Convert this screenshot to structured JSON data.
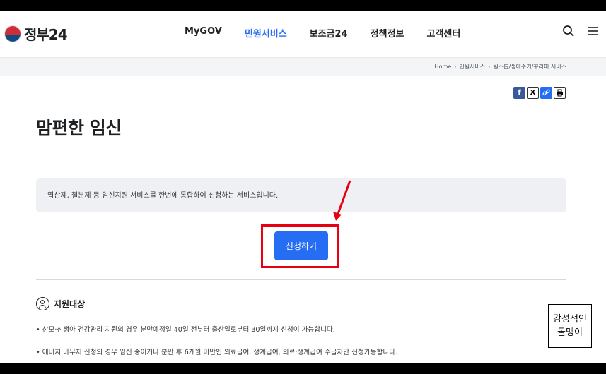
{
  "header": {
    "logo_text": "정부24",
    "nav": [
      {
        "label": "MyGOV",
        "active": false
      },
      {
        "label": "민원서비스",
        "active": true
      },
      {
        "label": "보조금24",
        "active": false
      },
      {
        "label": "정책정보",
        "active": false
      },
      {
        "label": "고객센터",
        "active": false
      }
    ],
    "icons": [
      "search-icon",
      "menu-icon"
    ]
  },
  "breadcrumb": [
    "Home",
    "민원서비스",
    "원스톱/생애주기/꾸러미 서비스"
  ],
  "share": [
    "facebook-icon",
    "x-icon",
    "link-icon",
    "print-icon"
  ],
  "page_title": "맘편한 임신",
  "description": "엽산제, 철분제 등 임신지원 서비스를 한번에 통합하여 신청하는 서비스입니다.",
  "apply_button": "신청하기",
  "section": {
    "title": "지원대상",
    "bullets": [
      "• 산모·신생아 건강관리 지원의 경우 분만예정일 40일 전부터 출산일로부터 30일까지 신청이 가능합니다.",
      "• 에너지 바우처 신청의 경우 임신 중이거나 분만 후 6개월 미만인 의료급여, 생계급여, 의료·생계급여 수급자만 신청가능합니다."
    ]
  },
  "stamp": {
    "line1": "감성적인",
    "line2": "돌멩이"
  },
  "colors": {
    "accent": "#256ef4",
    "highlight": "#e60012"
  }
}
